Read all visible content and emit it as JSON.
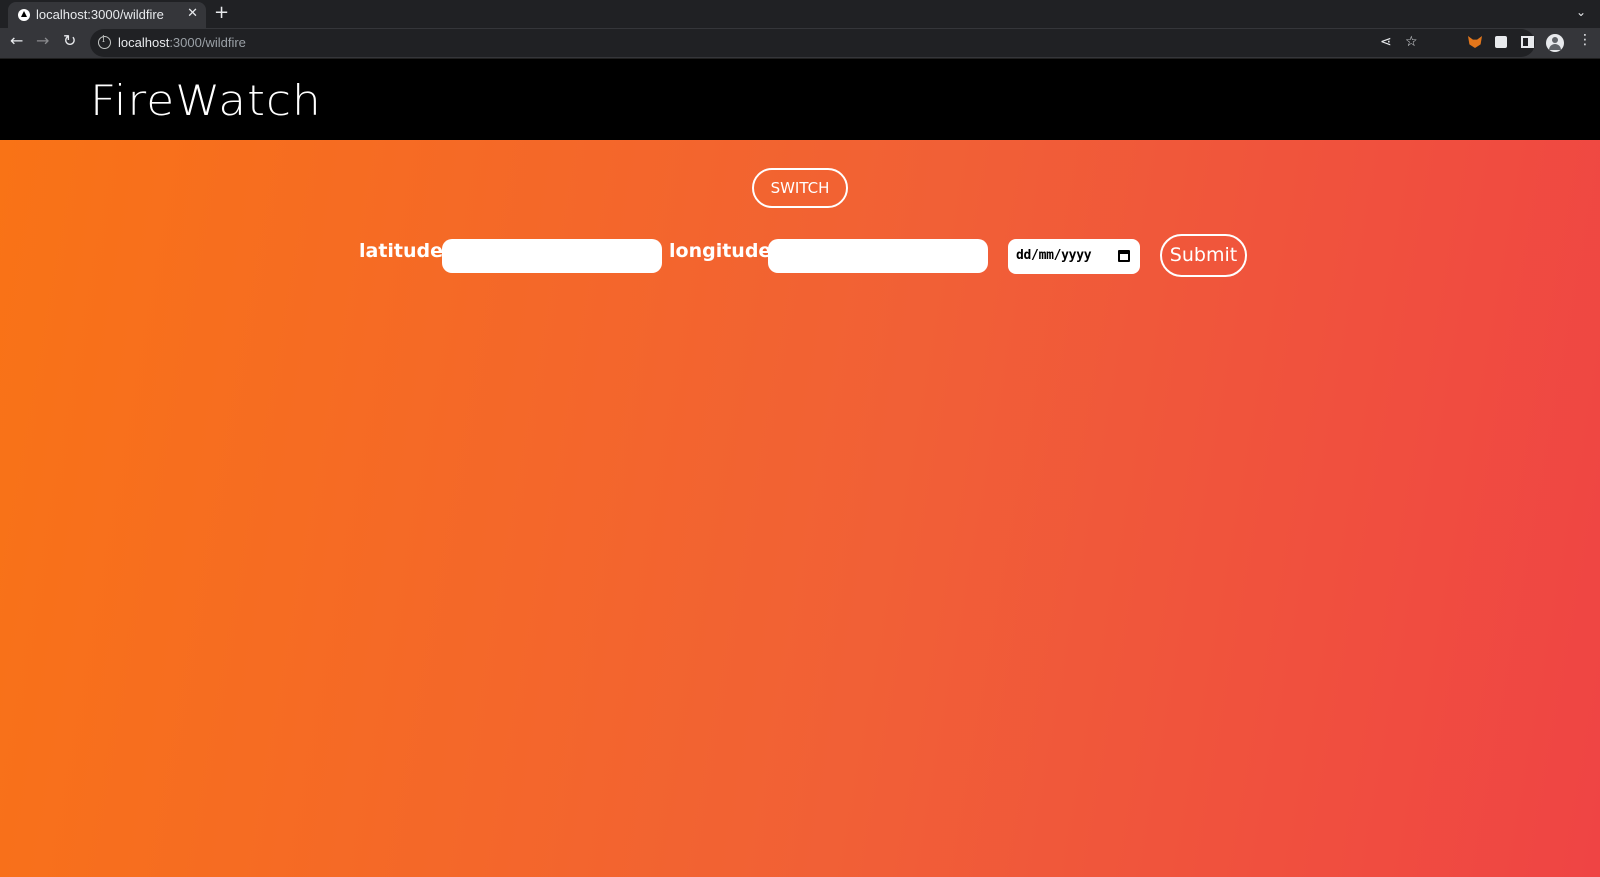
{
  "browser": {
    "tab_title": "localhost:3000/wildfire",
    "tab_close": "✕",
    "new_tab": "+",
    "tab_list": "⌄",
    "back": "←",
    "forward": "→",
    "reload": "↻",
    "url_host": "localhost",
    "url_path": ":3000/wildfire",
    "share": "⋖",
    "bookmark": "☆",
    "menu": "⋮"
  },
  "header": {
    "brand": "FireWatch"
  },
  "form": {
    "switch_label": "SWITCH",
    "latitude_label": "latitude",
    "latitude_value": "",
    "longitude_label": "longitude",
    "longitude_value": "",
    "date_placeholder": "dd/mm/yyyy",
    "submit_label": "Submit"
  },
  "colors": {
    "gradient_start": "#f97316",
    "gradient_end": "#ef4444",
    "header_bg": "#000000"
  }
}
